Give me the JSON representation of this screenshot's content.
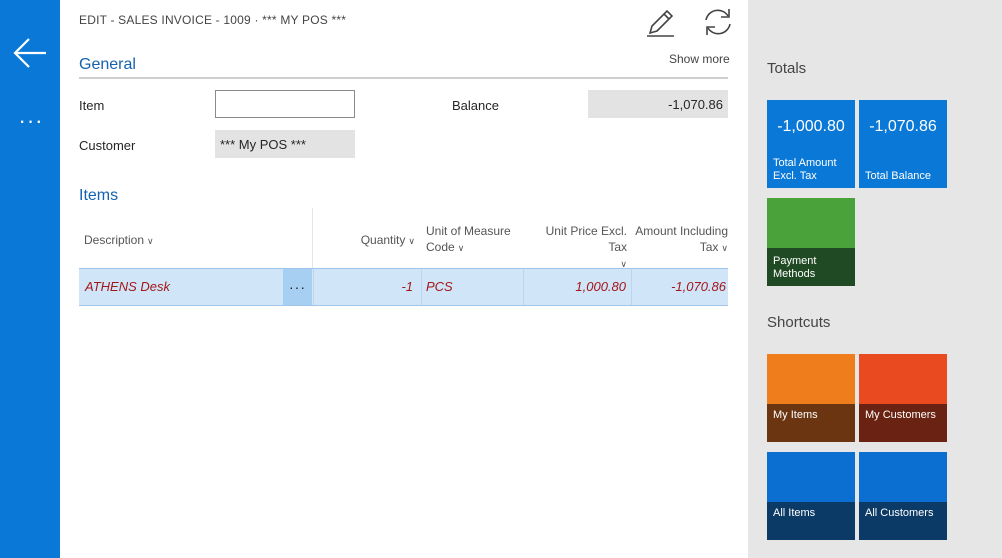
{
  "breadcrumb": "EDIT - SALES INVOICE - 1009 · *** MY POS ***",
  "actions": {
    "show_more": "Show more"
  },
  "general": {
    "title": "General",
    "item_label": "Item",
    "item_value": "",
    "customer_label": "Customer",
    "customer_value": "*** My POS ***",
    "balance_label": "Balance",
    "balance_value": "-1,070.86"
  },
  "items": {
    "title": "Items",
    "columns": {
      "description": "Description",
      "quantity": "Quantity",
      "uom_line1": "Unit of Measure",
      "uom_line2": "Code",
      "price": "Unit Price Excl. Tax",
      "amount_line1": "Amount Including",
      "amount_line2": "Tax"
    },
    "rows": [
      {
        "description": "ATHENS Desk",
        "quantity": "-1",
        "uom": "PCS",
        "price": "1,000.80",
        "amount": "-1,070.86"
      }
    ],
    "row_menu": "···"
  },
  "rail": {
    "more": "···"
  },
  "totals": {
    "title": "Totals",
    "tiles": [
      {
        "value": "-1,000.80",
        "caption_line1": "Total Amount",
        "caption_line2": "Excl. Tax",
        "color": "#0a78d7"
      },
      {
        "value": "-1,070.86",
        "caption_line1": "Total Balance",
        "caption_line2": "",
        "color": "#0a78d7"
      },
      {
        "value": "",
        "caption_line1": "Payment",
        "caption_line2": "Methods",
        "color": "#4aa23a"
      }
    ]
  },
  "shortcuts": {
    "title": "Shortcuts",
    "tiles": [
      {
        "caption": "My Items",
        "color": "#f07d1b"
      },
      {
        "caption": "My Customers",
        "color": "#ea4a1f"
      },
      {
        "caption": "All Items",
        "color": "#0a6fd0"
      },
      {
        "caption": "All Customers",
        "color": "#0a6fd0"
      }
    ]
  },
  "colors": {
    "rail": "#0a78d7",
    "accent_text": "#1462b0",
    "row_text": "#a3171a",
    "row_bg": "#d0e6f8"
  },
  "icons": {
    "back": "arrow-left-icon",
    "edit": "pencil-icon",
    "refresh": "refresh-icon",
    "more": "ellipsis-icon"
  }
}
